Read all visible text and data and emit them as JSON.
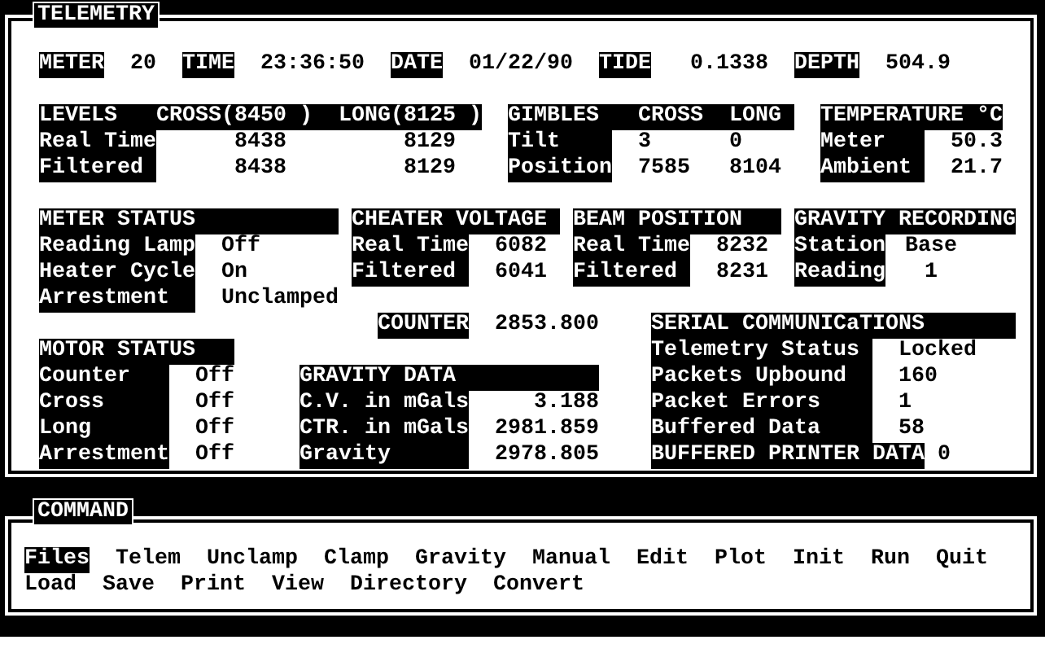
{
  "telemetry": {
    "title": "TELEMETRY",
    "readouts": [
      {
        "label": "METER",
        "value": "20"
      },
      {
        "label": "TIME",
        "value": "23:36:50"
      },
      {
        "label": "DATE",
        "value": "01/22/90"
      },
      {
        "label": "TIDE",
        "value": "0.1338"
      },
      {
        "label": "DEPTH",
        "value": "504.9"
      },
      {
        "label": "COUNTER",
        "value": "2853.800"
      },
      {
        "label": "BUFFERED PRINTER DATA",
        "value": "0"
      }
    ],
    "sections": [
      {
        "header": [
          "LEVELS",
          "CROSS(8450 )",
          "LONG(8125 )"
        ],
        "rows": [
          {
            "label": "Real Time",
            "values": [
              "8438",
              "8129"
            ]
          },
          {
            "label": "Filtered",
            "values": [
              "8438",
              "8129"
            ]
          }
        ]
      },
      {
        "header": [
          "GIMBLES",
          "CROSS",
          "LONG"
        ],
        "rows": [
          {
            "label": "Tilt",
            "values": [
              "3",
              "0"
            ]
          },
          {
            "label": "Position",
            "values": [
              "7585",
              "8104"
            ]
          }
        ]
      },
      {
        "header": [
          "TEMPERATURE °C"
        ],
        "rows": [
          {
            "label": "Meter",
            "values": [
              "50.3"
            ]
          },
          {
            "label": "Ambient",
            "values": [
              "21.7"
            ]
          }
        ]
      },
      {
        "header": [
          "METER STATUS"
        ],
        "rows": [
          {
            "label": "Reading Lamp",
            "values": [
              "Off"
            ]
          },
          {
            "label": "Heater Cycle",
            "values": [
              "On"
            ]
          },
          {
            "label": "Arrestment",
            "values": [
              "Unclamped"
            ]
          }
        ]
      },
      {
        "header": [
          "CHEATER VOLTAGE"
        ],
        "rows": [
          {
            "label": "Real Time",
            "values": [
              "6082"
            ]
          },
          {
            "label": "Filtered",
            "values": [
              "6041"
            ]
          }
        ]
      },
      {
        "header": [
          "BEAM POSITION"
        ],
        "rows": [
          {
            "label": "Real Time",
            "values": [
              "8232"
            ]
          },
          {
            "label": "Filtered",
            "values": [
              "8231"
            ]
          }
        ]
      },
      {
        "header": [
          "GRAVITY RECORDING"
        ],
        "rows": [
          {
            "label": "Station",
            "values": [
              "Base"
            ]
          },
          {
            "label": "Reading",
            "values": [
              "1"
            ]
          }
        ]
      },
      {
        "header": [
          "MOTOR STATUS"
        ],
        "rows": [
          {
            "label": "Counter",
            "values": [
              "Off"
            ]
          },
          {
            "label": "Cross",
            "values": [
              "Off"
            ]
          },
          {
            "label": "Long",
            "values": [
              "Off"
            ]
          },
          {
            "label": "Arrestment",
            "values": [
              "Off"
            ]
          }
        ]
      },
      {
        "header": [
          "GRAVITY DATA"
        ],
        "rows": [
          {
            "label": "C.V. in mGals",
            "values": [
              "3.188"
            ]
          },
          {
            "label": "CTR. in mGals",
            "values": [
              "2981.859"
            ]
          },
          {
            "label": "Gravity",
            "values": [
              "2978.805"
            ]
          }
        ]
      },
      {
        "header": [
          "SERIAL COMMUNICaTIONS"
        ],
        "rows": [
          {
            "label": "Telemetry Status",
            "values": [
              "Locked"
            ]
          },
          {
            "label": "Packets Upbound",
            "values": [
              "160"
            ]
          },
          {
            "label": "Packet Errors",
            "values": [
              "1"
            ]
          },
          {
            "label": "Buffered Data",
            "values": [
              "58"
            ]
          }
        ]
      }
    ]
  },
  "command": {
    "title": "COMMAND",
    "menu_rows": [
      {
        "items": [
          {
            "label": "Files",
            "selected": true
          },
          {
            "label": "Telem",
            "selected": false
          },
          {
            "label": "Unclamp",
            "selected": false
          },
          {
            "label": "Clamp",
            "selected": false
          },
          {
            "label": "Gravity",
            "selected": false
          },
          {
            "label": "Manual",
            "selected": false
          },
          {
            "label": "Edit",
            "selected": false
          },
          {
            "label": "Plot",
            "selected": false
          },
          {
            "label": "Init",
            "selected": false
          },
          {
            "label": "Run",
            "selected": false
          },
          {
            "label": "Quit",
            "selected": false
          }
        ]
      },
      {
        "items": [
          {
            "label": "Load",
            "selected": false
          },
          {
            "label": "Save",
            "selected": false
          },
          {
            "label": "Print",
            "selected": false
          },
          {
            "label": "View",
            "selected": false
          },
          {
            "label": "Directory",
            "selected": false
          },
          {
            "label": "Convert",
            "selected": false
          }
        ]
      }
    ]
  }
}
